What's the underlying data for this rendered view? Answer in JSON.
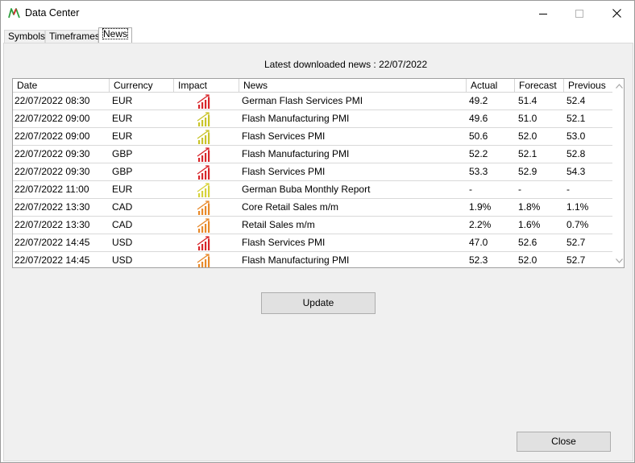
{
  "window": {
    "title": "Data Center",
    "accent": "#2e9e3e"
  },
  "tabs": [
    {
      "label": "Symbols",
      "active": false
    },
    {
      "label": "Timeframes",
      "active": false
    },
    {
      "label": "News",
      "active": true
    }
  ],
  "news": {
    "latest_text": "Latest downloaded news : 22/07/2022",
    "columns": [
      "Date",
      "Currency",
      "Impact",
      "News",
      "Actual",
      "Forecast",
      "Previous"
    ],
    "rows": [
      {
        "date": "22/07/2022 08:30",
        "currency": "EUR",
        "impact": "high",
        "news": "German Flash Services PMI",
        "actual": "49.2",
        "forecast": "51.4",
        "previous": "52.4"
      },
      {
        "date": "22/07/2022 09:00",
        "currency": "EUR",
        "impact": "medium",
        "news": "Flash Manufacturing PMI",
        "actual": "49.6",
        "forecast": "51.0",
        "previous": "52.1"
      },
      {
        "date": "22/07/2022 09:00",
        "currency": "EUR",
        "impact": "medium",
        "news": "Flash Services PMI",
        "actual": "50.6",
        "forecast": "52.0",
        "previous": "53.0"
      },
      {
        "date": "22/07/2022 09:30",
        "currency": "GBP",
        "impact": "high",
        "news": "Flash Manufacturing PMI",
        "actual": "52.2",
        "forecast": "52.1",
        "previous": "52.8"
      },
      {
        "date": "22/07/2022 09:30",
        "currency": "GBP",
        "impact": "high",
        "news": "Flash Services PMI",
        "actual": "53.3",
        "forecast": "52.9",
        "previous": "54.3"
      },
      {
        "date": "22/07/2022 11:00",
        "currency": "EUR",
        "impact": "low",
        "news": "German Buba Monthly Report",
        "actual": "-",
        "forecast": "-",
        "previous": "-"
      },
      {
        "date": "22/07/2022 13:30",
        "currency": "CAD",
        "impact": "medium-high",
        "news": "Core Retail Sales m/m",
        "actual": "1.9%",
        "forecast": "1.8%",
        "previous": "1.1%"
      },
      {
        "date": "22/07/2022 13:30",
        "currency": "CAD",
        "impact": "medium-high",
        "news": "Retail Sales m/m",
        "actual": "2.2%",
        "forecast": "1.6%",
        "previous": "0.7%"
      },
      {
        "date": "22/07/2022 14:45",
        "currency": "USD",
        "impact": "high",
        "news": "Flash Services PMI",
        "actual": "47.0",
        "forecast": "52.6",
        "previous": "52.7"
      },
      {
        "date": "22/07/2022 14:45",
        "currency": "USD",
        "impact": "medium-high",
        "news": "Flash Manufacturing PMI",
        "actual": "52.3",
        "forecast": "52.0",
        "previous": "52.7"
      }
    ],
    "impact_colors": {
      "high": "#d8262b",
      "medium-high": "#e8892a",
      "medium": "#c9c42a",
      "low": "#d6d23a"
    }
  },
  "buttons": {
    "update_label": "Update",
    "close_label": "Close"
  }
}
